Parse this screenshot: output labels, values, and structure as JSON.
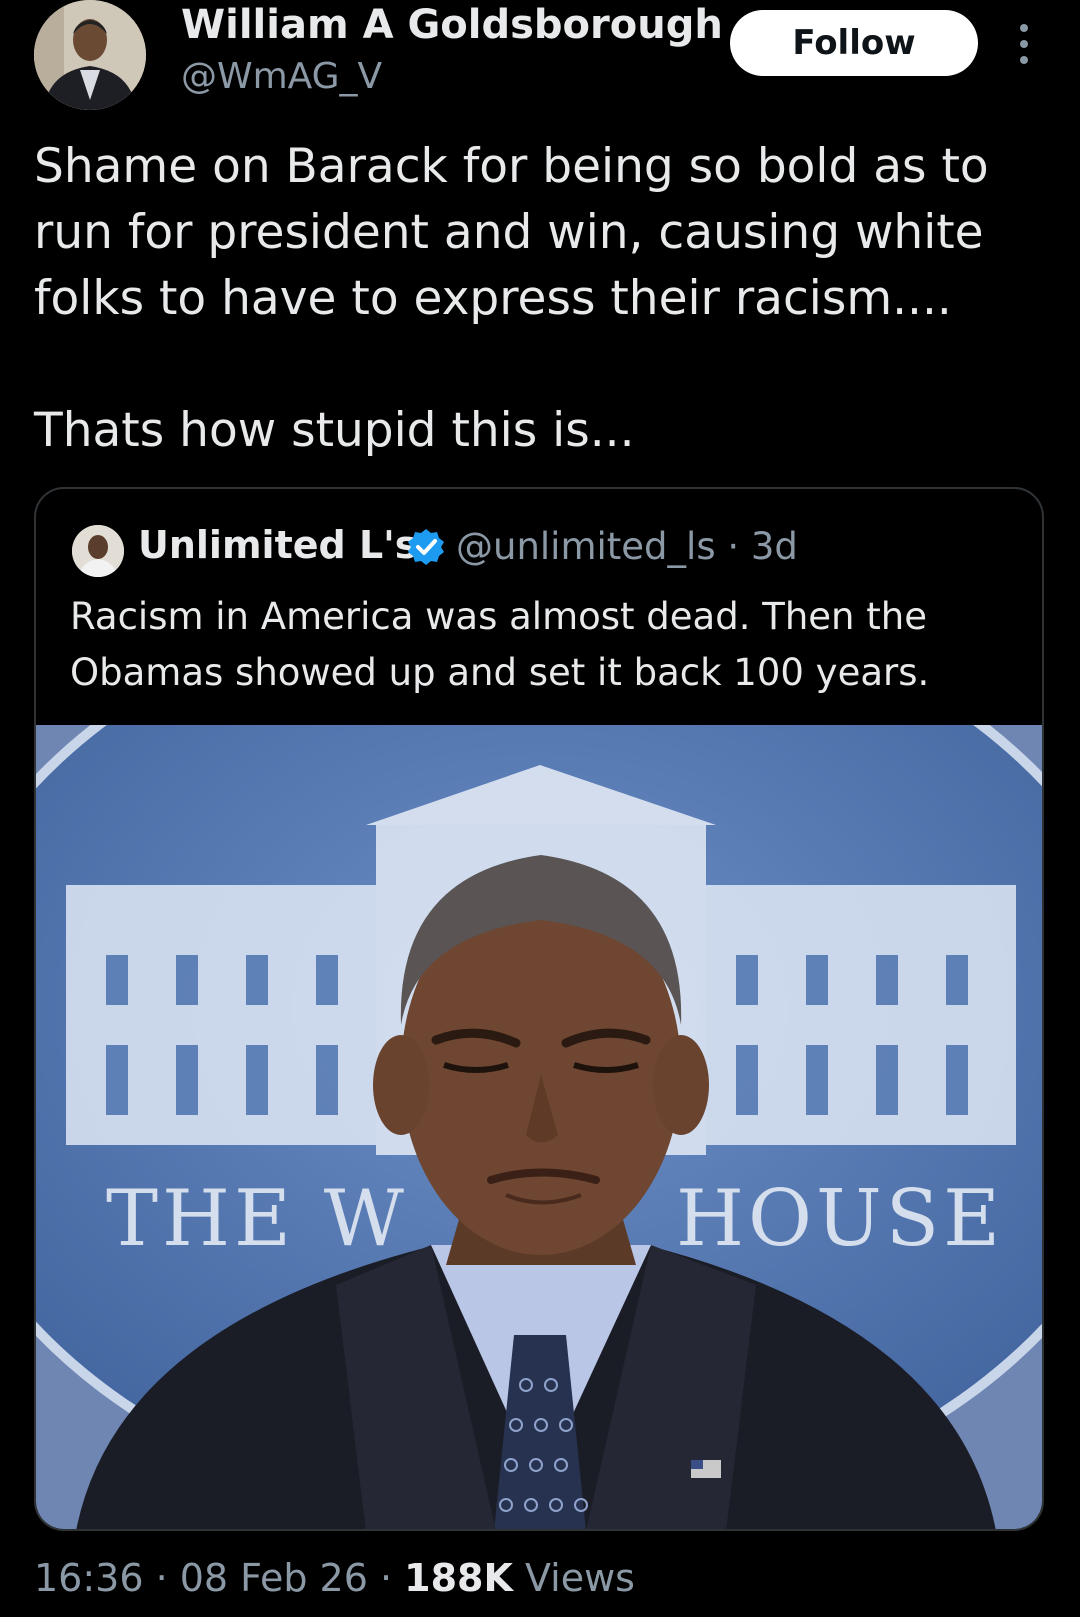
{
  "author": {
    "name": "William A Goldsborough",
    "handle": "@WmAG_V",
    "follow_label": "Follow"
  },
  "tweet": {
    "line1": "Shame on Barack for being so bold as to run for president and win, causing white folks to have to express their racism....",
    "line2": "Thats how stupid this is..."
  },
  "quoted": {
    "name": "Unlimited L's",
    "handle": "@unlimited_ls · 3d",
    "text": "Racism in America was almost dead. Then the Obamas showed up and set it back 100 years.",
    "image": {
      "backdrop_left": "THE W",
      "backdrop_right": "HOUSE"
    }
  },
  "meta": {
    "time_date": "16:36 · 08 Feb 26 · ",
    "views_count": "188K",
    "views_label": " Views"
  },
  "colors": {
    "background": "#000000",
    "text": "#e7e9ea",
    "muted": "#8b98a5",
    "verified": "#1d9bf0",
    "border": "#2f3336"
  }
}
